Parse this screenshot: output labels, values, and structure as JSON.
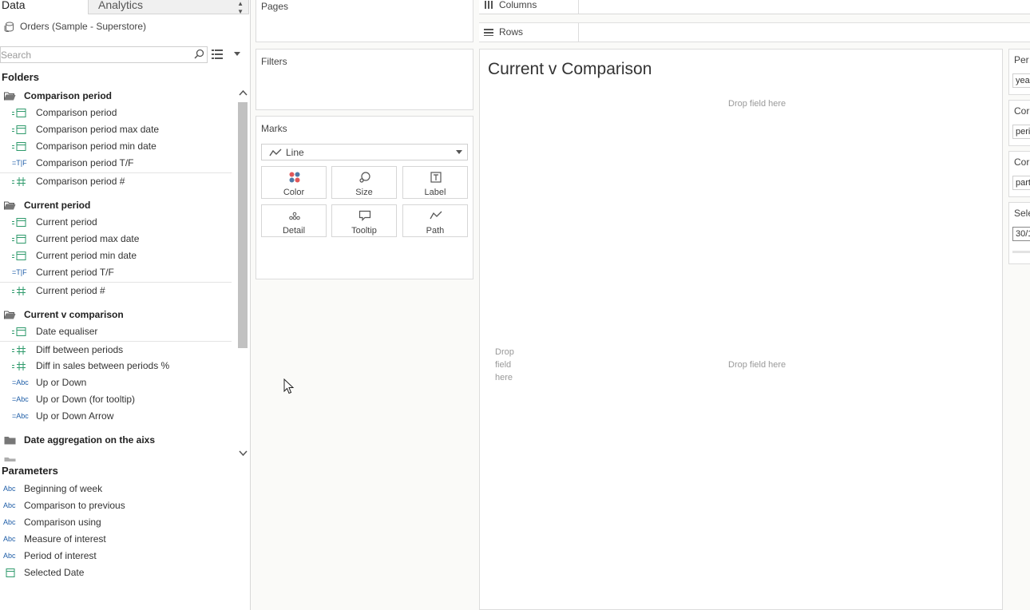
{
  "left": {
    "tab_data": "Data",
    "tab_analytics": "Analytics",
    "datasource": "Orders (Sample - Superstore)",
    "search_placeholder": "Search",
    "folders_heading": "Folders",
    "groups": [
      {
        "label": "Comparison period",
        "fields": [
          {
            "label": "Comparison period",
            "icon": "calendar-icon"
          },
          {
            "label": "Comparison period max date",
            "icon": "calendar-icon"
          },
          {
            "label": "Comparison period min date",
            "icon": "calendar-icon"
          },
          {
            "label": "Comparison period T/F",
            "icon": "boolean-icon"
          },
          {
            "label": "Comparison period #",
            "icon": "number-icon"
          }
        ]
      },
      {
        "label": "Current period",
        "fields": [
          {
            "label": "Current period",
            "icon": "calendar-icon"
          },
          {
            "label": "Current period max date",
            "icon": "calendar-icon"
          },
          {
            "label": "Current period min date",
            "icon": "calendar-icon"
          },
          {
            "label": "Current period T/F",
            "icon": "boolean-icon"
          },
          {
            "label": "Current period #",
            "icon": "number-icon"
          }
        ]
      },
      {
        "label": "Current v comparison",
        "fields": [
          {
            "label": "Date equaliser",
            "icon": "calendar-icon"
          },
          {
            "label": "Diff between periods",
            "icon": "number-icon"
          },
          {
            "label": "Diff in sales between periods %",
            "icon": "number-icon"
          },
          {
            "label": "Up or Down",
            "icon": "string-icon"
          },
          {
            "label": "Up or Down (for tooltip)",
            "icon": "string-icon"
          },
          {
            "label": "Up or Down Arrow",
            "icon": "string-icon"
          }
        ]
      },
      {
        "label": "Date aggregation on the aixs",
        "fields": []
      }
    ],
    "params_heading": "Parameters",
    "parameters": [
      {
        "label": "Beginning of week",
        "icon": "string-icon"
      },
      {
        "label": "Comparison to previous",
        "icon": "string-icon"
      },
      {
        "label": "Comparison using",
        "icon": "string-icon"
      },
      {
        "label": "Measure of interest",
        "icon": "string-icon"
      },
      {
        "label": "Period of interest",
        "icon": "string-icon"
      },
      {
        "label": "Selected Date",
        "icon": "calendar-icon"
      }
    ]
  },
  "cards": {
    "pages": "Pages",
    "filters": "Filters",
    "marks": "Marks",
    "mark_type": "Line",
    "mark_buttons": [
      "Color",
      "Size",
      "Label",
      "Detail",
      "Tooltip",
      "Path"
    ]
  },
  "shelves": {
    "columns": "Columns",
    "rows": "Rows"
  },
  "canvas": {
    "title": "Current v Comparison",
    "drop_columns": "Drop field here",
    "drop_rows": "Drop field here",
    "drop_main": "Drop field here"
  },
  "controls": [
    {
      "title": "Per",
      "value": "yea"
    },
    {
      "title": "Cor",
      "value": "peri"
    },
    {
      "title": "Cor",
      "value": "part"
    },
    {
      "title": "Sele",
      "value": "30/1"
    }
  ],
  "colors": {
    "accent_blue": "#1f5ea8",
    "field_green": "#2e9a6b",
    "color_dot_red": "#e15759",
    "color_dot_blue": "#4e79a7"
  }
}
